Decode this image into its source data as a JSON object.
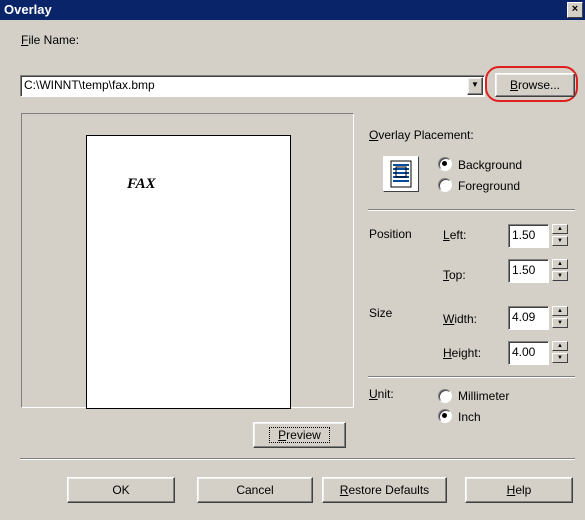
{
  "window": {
    "title": "Overlay",
    "close_glyph": "×"
  },
  "file": {
    "label_prefix": "",
    "label_accel": "F",
    "label_rest": "ile Name:",
    "value": "C:\\WINNT\\temp\\fax.bmp"
  },
  "browse": {
    "accel": "B",
    "rest": "rowse..."
  },
  "preview_page": {
    "text": "FAX"
  },
  "preview_button": {
    "accel": "P",
    "rest": "review"
  },
  "placement": {
    "label_accel": "O",
    "label_rest": "verlay Placement:",
    "options": [
      {
        "label": "Background",
        "selected": true
      },
      {
        "label": "Foreground",
        "selected": false
      }
    ]
  },
  "position": {
    "label": "Position",
    "left": {
      "accel": "L",
      "rest": "eft:",
      "value": "1.50"
    },
    "top": {
      "accel": "T",
      "rest": "op:",
      "value": "1.50"
    }
  },
  "size": {
    "label": "Size",
    "width": {
      "accel": "W",
      "rest": "idth:",
      "value": "4.09"
    },
    "height": {
      "accel": "H",
      "rest": "eight:",
      "value": "4.00"
    }
  },
  "unit": {
    "label_accel": "U",
    "label_rest": "nit:",
    "options": [
      {
        "label": "Millimeter",
        "selected": false
      },
      {
        "label": "Inch",
        "selected": true
      }
    ]
  },
  "footer": {
    "ok": "OK",
    "cancel": "Cancel",
    "restore": {
      "accel": "R",
      "rest": "estore Defaults"
    },
    "help": {
      "accel": "H",
      "rest": "elp"
    }
  },
  "colors": {
    "titlebar": "#0a246a",
    "face": "#d4d0c8",
    "highlight_ring": "#e0201e"
  }
}
